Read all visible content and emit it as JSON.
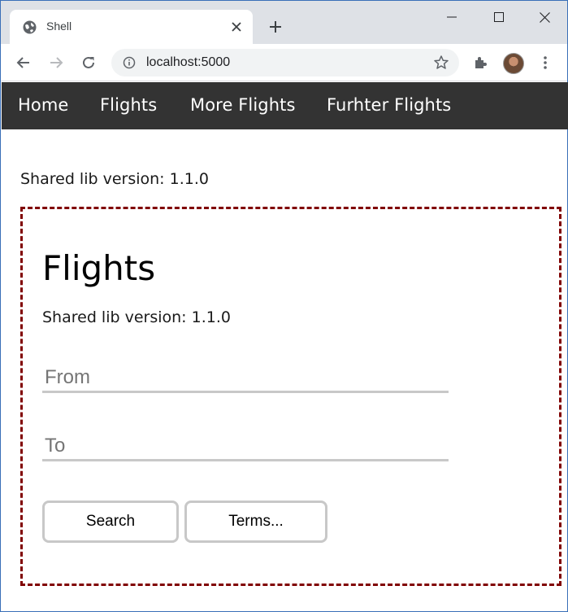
{
  "browser": {
    "tab": {
      "title": "Shell",
      "favicon": "globe-icon"
    },
    "address": {
      "url": "localhost:5000"
    },
    "colors": {
      "tabstrip": "#dee1e6",
      "frame_border": "#3a6fb8"
    }
  },
  "nav": {
    "items": [
      {
        "label": "Home"
      },
      {
        "label": "Flights"
      },
      {
        "label": "More Flights"
      },
      {
        "label": "Furhter Flights"
      }
    ],
    "background": "#333333"
  },
  "shell": {
    "version_text": "Shared lib version: 1.1.0"
  },
  "microfrontend": {
    "title": "Flights",
    "version_text": "Shared lib version: 1.1.0",
    "from": {
      "placeholder": "From",
      "value": ""
    },
    "to": {
      "placeholder": "To",
      "value": ""
    },
    "search_label": "Search",
    "terms_label": "Terms...",
    "border_color": "#800000"
  }
}
